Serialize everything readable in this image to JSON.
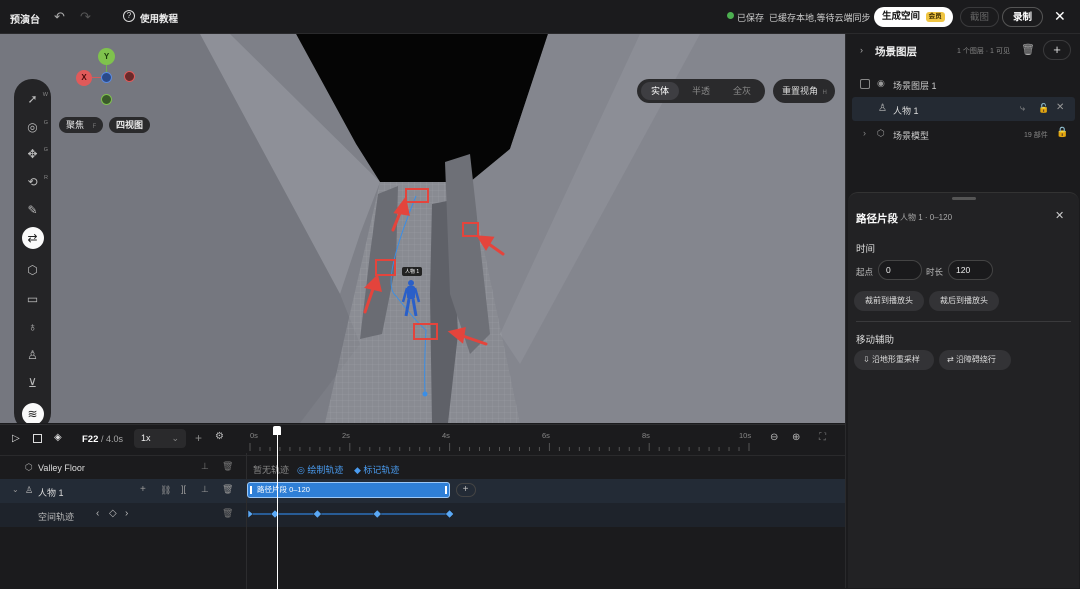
{
  "app": {
    "title": "预演台",
    "help_label": "使用教程"
  },
  "status": {
    "saved": "已保存",
    "sync": "已缓存本地,等待云端同步"
  },
  "actions": {
    "generate": "生成空间",
    "member_badge": "会员",
    "screenshot": "截图",
    "record": "录制"
  },
  "viewport": {
    "render_modes": [
      "实体",
      "半透",
      "全灰"
    ],
    "active_mode": "实体",
    "reset_view": "重置视角",
    "reset_key": "H",
    "focus_label": "聚焦",
    "focus_key": "F",
    "four_view": "四视图",
    "gizmo": {
      "y": "Y",
      "x": "X"
    },
    "figure_tag": "人物 1",
    "tools": [
      {
        "icon": "select-arrow-icon",
        "key": "W"
      },
      {
        "icon": "compass-icon",
        "key": "G"
      },
      {
        "icon": "move-icon",
        "key": "G"
      },
      {
        "icon": "rotate-icon",
        "key": "R"
      },
      {
        "icon": "pen-icon",
        "key": ""
      },
      {
        "icon": "path-icon",
        "key": ""
      },
      {
        "icon": "cube-icon",
        "key": ""
      },
      {
        "icon": "camera-icon",
        "key": ""
      },
      {
        "icon": "light-icon",
        "key": ""
      },
      {
        "icon": "person-icon",
        "key": ""
      },
      {
        "icon": "import-icon",
        "key": ""
      },
      {
        "icon": "route-icon",
        "key": ""
      }
    ]
  },
  "layers": {
    "title": "场景图层",
    "summary": "1 个图层 · 1 可见",
    "items": [
      {
        "name": "场景图层 1",
        "type": "layer"
      },
      {
        "name": "人物 1",
        "type": "person"
      },
      {
        "name": "场景模型",
        "type": "model",
        "count": "19 部件"
      }
    ]
  },
  "segment": {
    "title": "路径片段",
    "subtitle": "人物 1 · 0–120",
    "time_heading": "时间",
    "start_label": "起点",
    "start_value": "0",
    "duration_label": "时长",
    "duration_value": "120",
    "trim_front": "裁前到播放头",
    "trim_back": "裁后到播放头",
    "assist_heading": "移动辅助",
    "resample": "沿地形重采样",
    "avoid": "沿障碍绕行"
  },
  "timeline": {
    "frame": "F22",
    "total": "/ 4.0s",
    "speed": "1x",
    "ticks": [
      "0s",
      "2s",
      "4s",
      "6s",
      "8s",
      "10s"
    ],
    "tracks": {
      "floor": "Valley Floor",
      "no_track": "暂无轨迹",
      "draw_track": "绘制轨迹",
      "mark_track": "标记轨迹",
      "person": "人物 1",
      "clip_label": "路径片段 0–120",
      "spatial": "空间轨迹"
    },
    "playhead_fraction": 0.055,
    "keyframes_s": [
      0,
      0.5,
      1.35,
      2.55,
      4.0
    ]
  },
  "colors": {
    "accent": "#2f7fd6",
    "highlight": "#e4443c",
    "gold": "#e5a93a"
  }
}
